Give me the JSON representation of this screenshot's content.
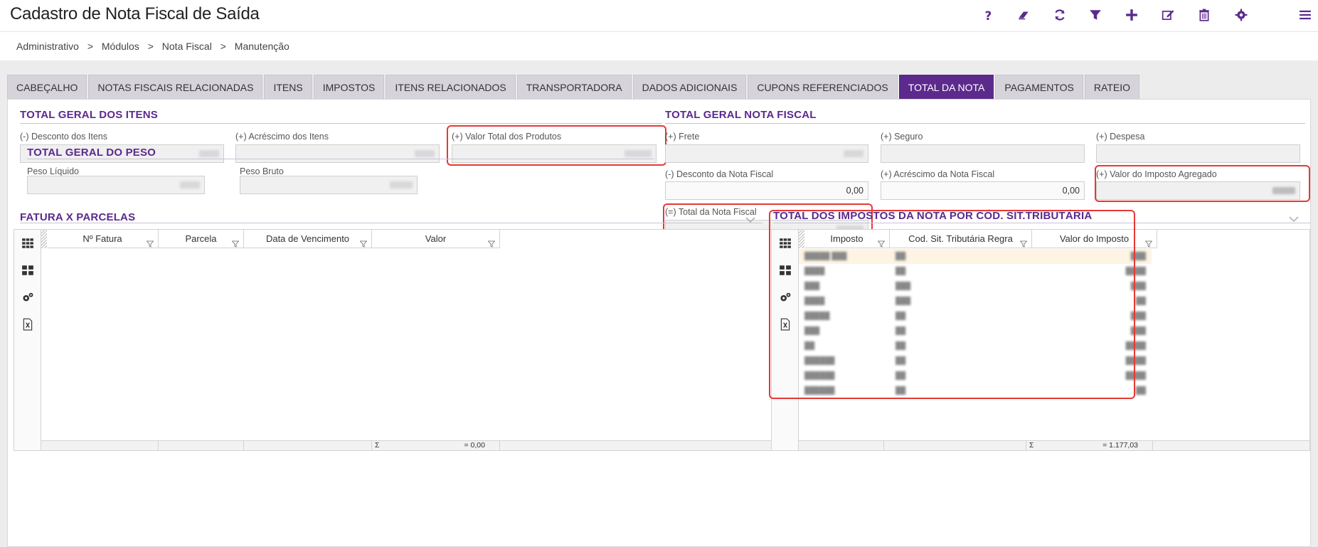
{
  "app": {
    "title": "Cadastro de Nota Fiscal de Saída"
  },
  "toolbar": {
    "icons": [
      "help-icon",
      "eraser-icon",
      "refresh-icon",
      "filter-icon",
      "plus-icon",
      "edit-icon",
      "trash-icon",
      "gear-icon",
      "menu-icon"
    ],
    "accent": "#5b2a8c"
  },
  "breadcrumb": {
    "items": [
      "Administrativo",
      ">",
      "Módulos",
      ">",
      "Nota Fiscal",
      ">",
      "Manutenção"
    ]
  },
  "tabs": [
    {
      "label": "CABEÇALHO"
    },
    {
      "label": "NOTAS FISCAIS RELACIONADAS"
    },
    {
      "label": "ITENS"
    },
    {
      "label": "IMPOSTOS"
    },
    {
      "label": "ITENS RELACIONADOS"
    },
    {
      "label": "TRANSPORTADORA"
    },
    {
      "label": "DADOS ADICIONAIS"
    },
    {
      "label": "CUPONS REFERENCIADOS"
    },
    {
      "label": "TOTAL DA NOTA",
      "active": true
    },
    {
      "label": "PAGAMENTOS"
    },
    {
      "label": "RATEIO"
    }
  ],
  "total_itens": {
    "title": "TOTAL GERAL DOS ITENS",
    "desconto_label": "(-) Desconto dos Itens",
    "acrescimo_label": "(+) Acréscimo dos Itens",
    "valor_total_label": "(+) Valor Total dos Produtos"
  },
  "total_peso": {
    "title": "TOTAL GERAL DO PESO",
    "liquido_label": "Peso Líquido",
    "bruto_label": "Peso Bruto"
  },
  "total_nota": {
    "title": "TOTAL GERAL NOTA FISCAL",
    "frete_label": "(+) Frete",
    "seguro_label": "(+) Seguro",
    "despesa_label": "(+) Despesa",
    "desconto_label": "(-) Desconto da Nota Fiscal",
    "desconto_value": "0,00",
    "acrescimo_label": "(+) Acréscimo da Nota Fiscal",
    "acrescimo_value": "0,00",
    "imposto_agregado_label": "(+) Valor do Imposto Agregado",
    "total_label": "(=) Total da Nota Fiscal"
  },
  "fatura": {
    "title": "FATURA X PARCELAS",
    "columns": [
      "Nº Fatura",
      "Parcela",
      "Data de Vencimento",
      "Valor"
    ],
    "sum_symbol": "Σ",
    "sum_value": "= 0,00"
  },
  "impostos": {
    "title": "TOTAL DOS IMPOSTOS DA NOTA POR CÓD. SIT.TRIBUTÁRIA",
    "columns": [
      "Imposto",
      "Cod. Sit. Tributária Regra",
      "Valor do Imposto"
    ],
    "sum_symbol": "Σ",
    "sum_value": "= 1.177,03"
  }
}
